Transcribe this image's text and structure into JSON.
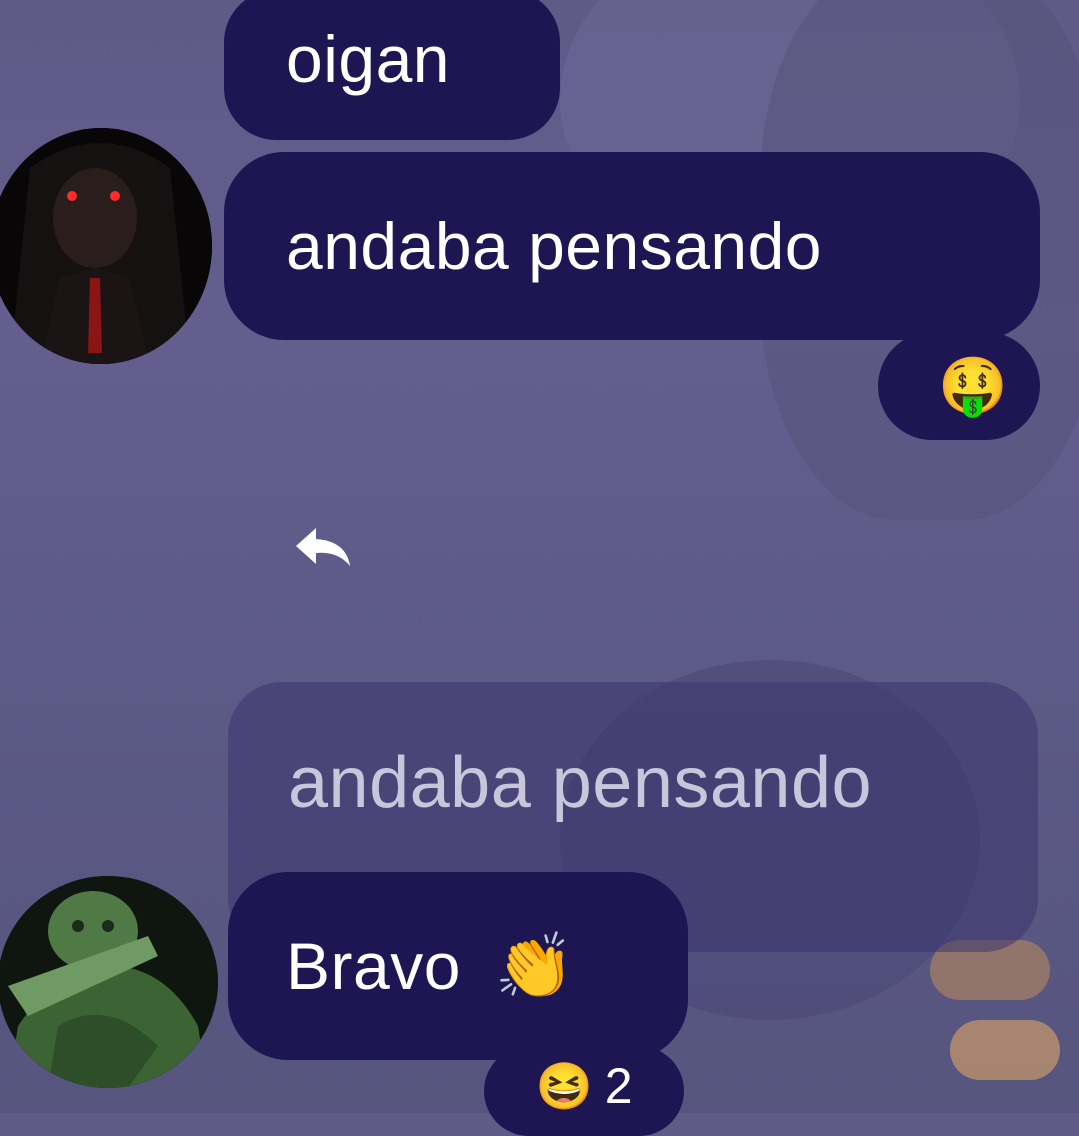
{
  "messages": [
    {
      "text": "oigan"
    },
    {
      "text": "andaba pensando"
    }
  ],
  "reaction_top": {
    "emoji": "🤑"
  },
  "reply": {
    "icon": "reply-arrow-icon",
    "quoted_text": "andaba pensando"
  },
  "bravo": {
    "text": "Bravo",
    "emoji": "👏"
  },
  "reaction_bottom": {
    "emoji": "😆",
    "count": "2"
  },
  "colors": {
    "bubble": "#1d1652",
    "background": "#625c8c",
    "text": "#ffffff"
  }
}
